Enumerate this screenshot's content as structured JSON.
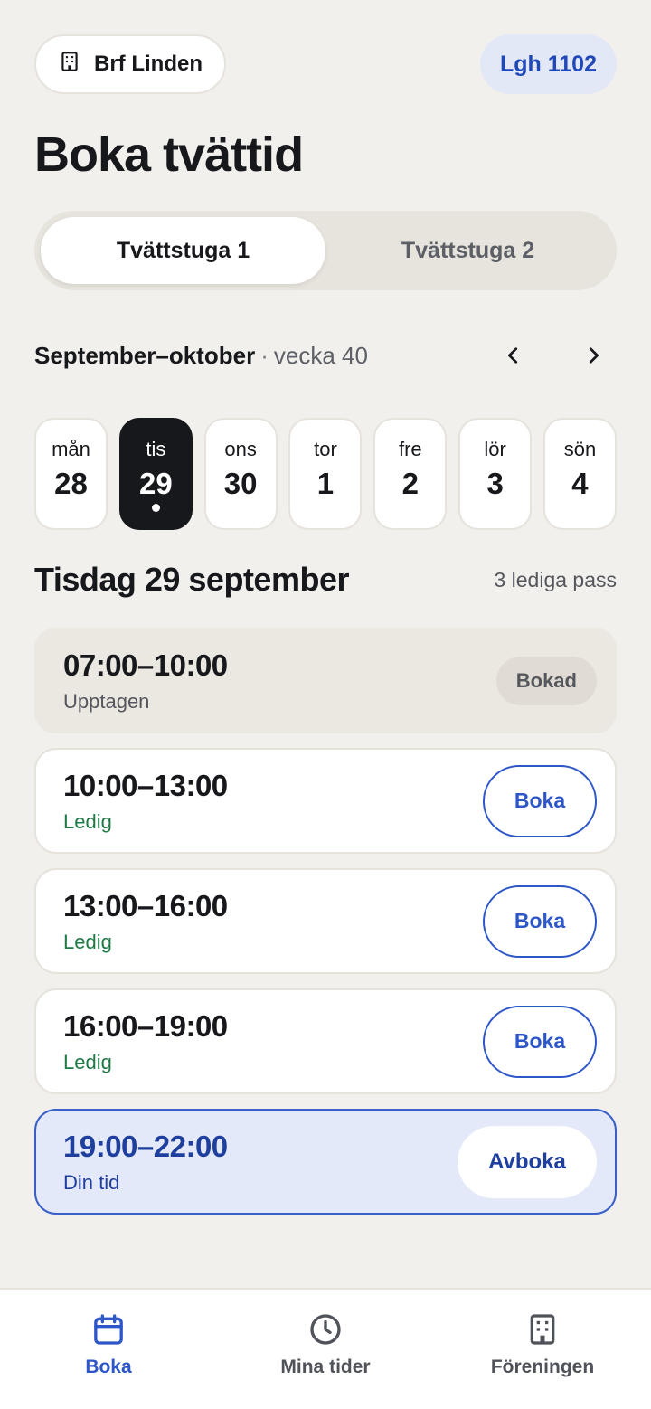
{
  "header": {
    "org_name": "Brf Linden",
    "apartment": "Lgh 1102"
  },
  "page_title": "Boka tvättid",
  "rooms": [
    {
      "label": "Tvättstuga 1",
      "active": true
    },
    {
      "label": "Tvättstuga 2",
      "active": false
    }
  ],
  "calendar": {
    "month_range": "September–oktober",
    "separator": "·",
    "week_label": "vecka 40",
    "days": [
      {
        "name": "mån",
        "date": "28"
      },
      {
        "name": "tis",
        "date": "29"
      },
      {
        "name": "ons",
        "date": "30"
      },
      {
        "name": "tor",
        "date": "1"
      },
      {
        "name": "fre",
        "date": "2"
      },
      {
        "name": "lör",
        "date": "3"
      },
      {
        "name": "sön",
        "date": "4"
      }
    ],
    "selected_index": 1
  },
  "day": {
    "title": "Tisdag 29 september",
    "free_count": "3 lediga pass"
  },
  "slots": [
    {
      "time": "07:00–10:00",
      "status": "Upptagen",
      "action": "Bokad",
      "state": "taken"
    },
    {
      "time": "10:00–13:00",
      "status": "Ledig",
      "action": "Boka",
      "state": "free"
    },
    {
      "time": "13:00–16:00",
      "status": "Ledig",
      "action": "Boka",
      "state": "free"
    },
    {
      "time": "16:00–19:00",
      "status": "Ledig",
      "action": "Boka",
      "state": "free"
    },
    {
      "time": "19:00–22:00",
      "status": "Din tid",
      "action": "Avboka",
      "state": "mine"
    }
  ],
  "nav": {
    "items": [
      {
        "label": "Boka",
        "icon": "calendar-icon",
        "active": true
      },
      {
        "label": "Mina tider",
        "icon": "clock-icon",
        "active": false
      },
      {
        "label": "Föreningen",
        "icon": "building-icon",
        "active": false
      }
    ]
  },
  "colors": {
    "background": "#f2f0ed",
    "accent": "#2d56c8",
    "free": "#1f7a45",
    "mine_bg": "#e3e9f8"
  }
}
